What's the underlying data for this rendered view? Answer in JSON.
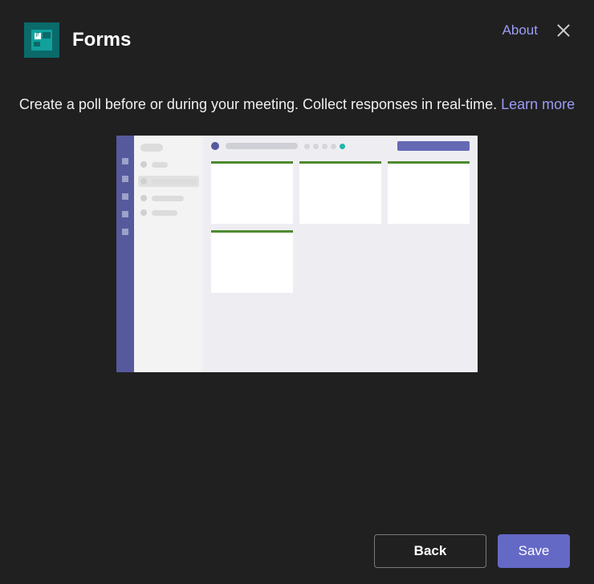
{
  "header": {
    "title": "Forms",
    "about": "About"
  },
  "body": {
    "description": "Create a poll before or during your meeting. Collect responses in real-time. ",
    "learn_more": "Learn more"
  },
  "footer": {
    "back": "Back",
    "save": "Save"
  }
}
